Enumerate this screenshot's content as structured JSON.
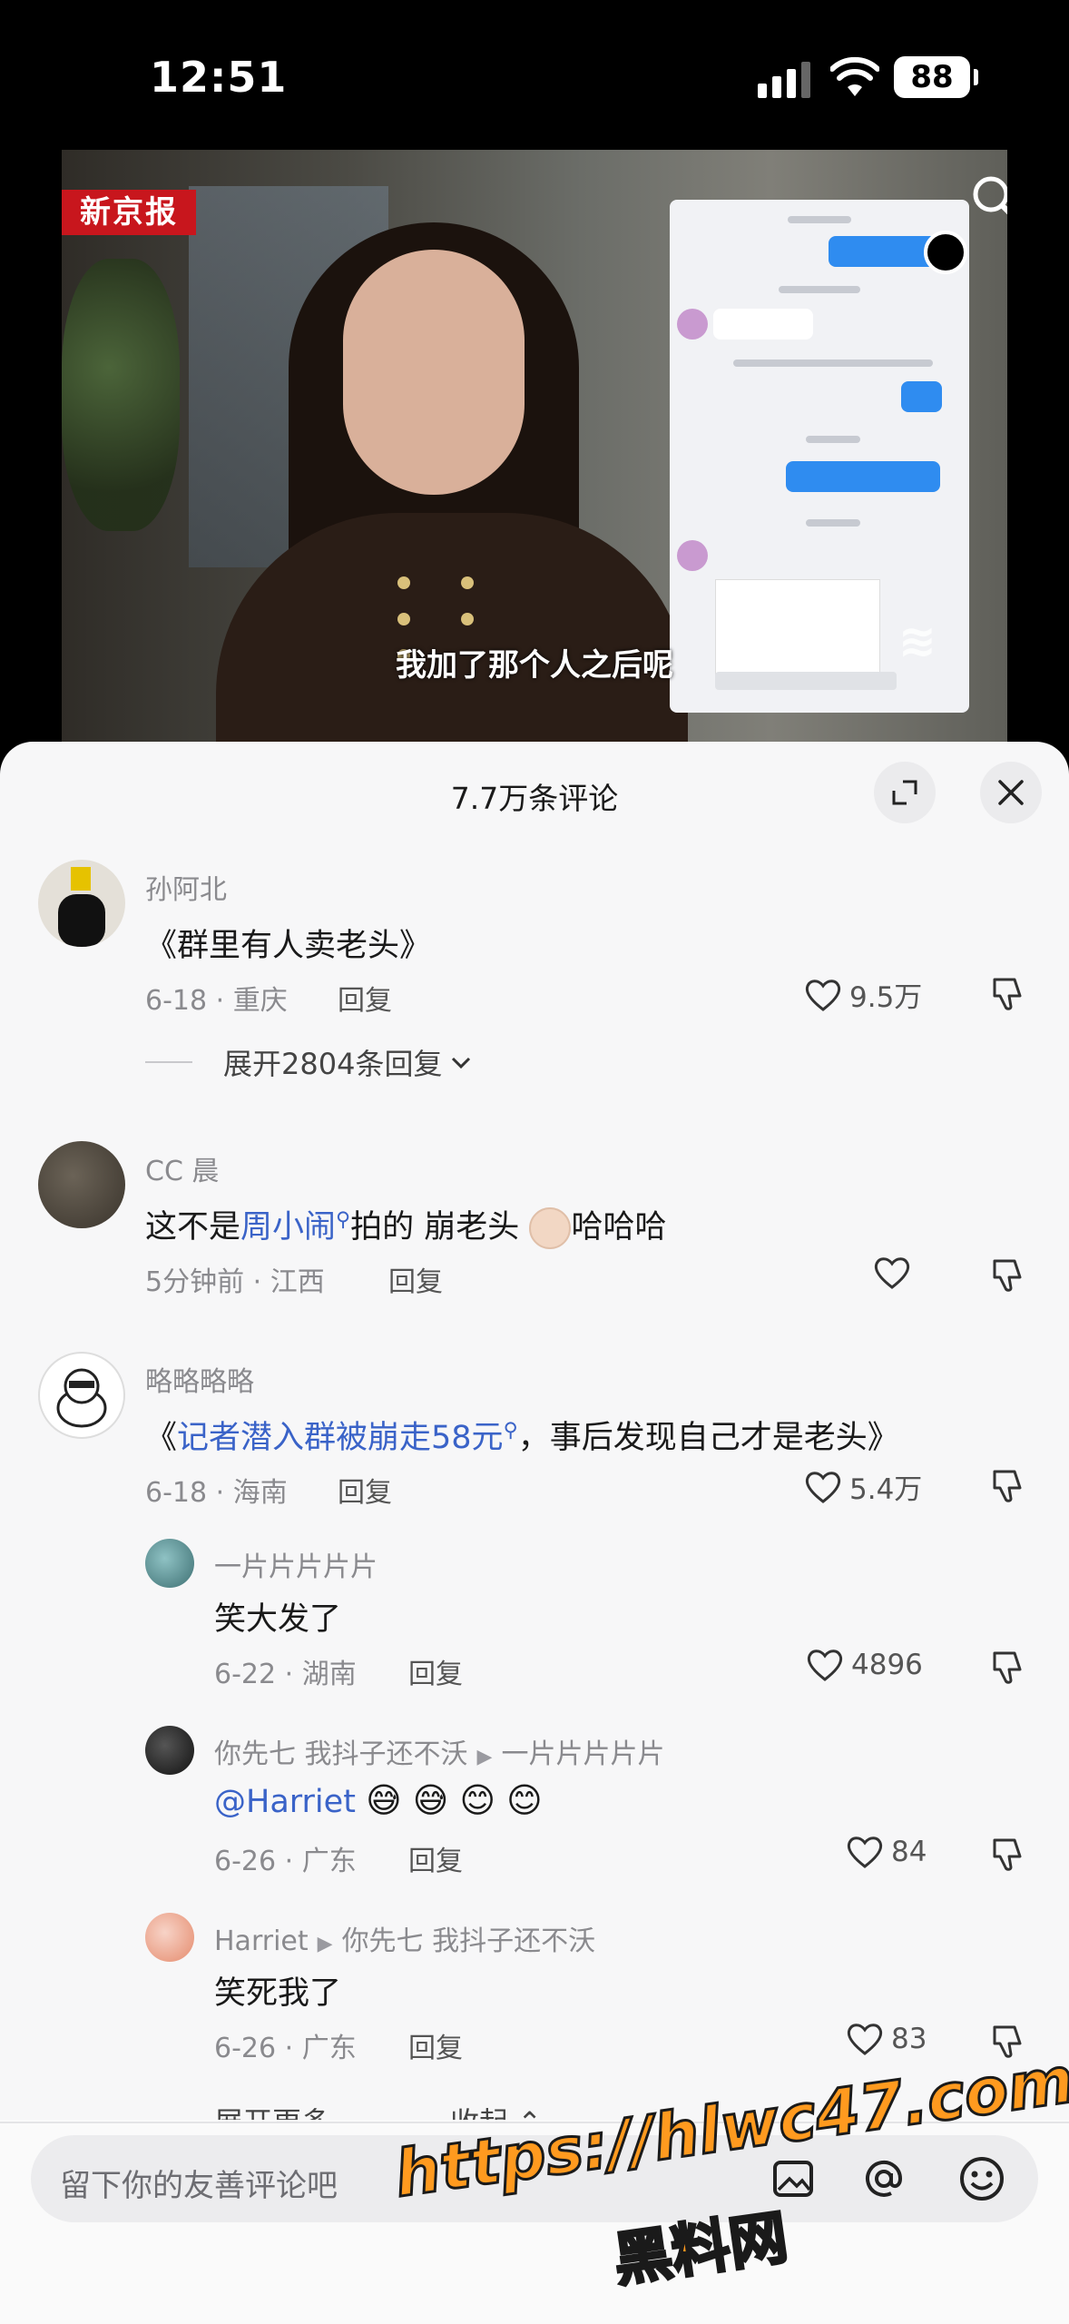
{
  "status_bar": {
    "time": "12:51",
    "battery": "88"
  },
  "video": {
    "brand": "新京报",
    "caption": "我加了那个人之后呢"
  },
  "sheet": {
    "title": "7.7万条评论"
  },
  "comments": [
    {
      "user": "孙阿北",
      "text": "《群里有人卖老头》",
      "meta": "6-18 · 重庆",
      "reply": "回复",
      "likes": "9.5万",
      "expand": "展开2804条回复"
    },
    {
      "user": "CC 晨",
      "text_before": "这不是",
      "link": "周小闹",
      "text_mid": "拍的  崩老头",
      "text_after": "哈哈哈",
      "meta": "5分钟前 · 江西",
      "reply": "回复"
    },
    {
      "user": "略略略略",
      "text_open": "《",
      "link": "记者潜入群被崩走58元",
      "text_after": "，事后发现自己才是老头》",
      "meta": "6-18 · 海南",
      "reply": "回复",
      "likes": "5.4万"
    }
  ],
  "replies": [
    {
      "user": "一片片片片片",
      "text": "笑大发了",
      "meta": "6-22 · 湖南",
      "reply": "回复",
      "likes": "4896"
    },
    {
      "user": "你先七 我抖子还不沃",
      "to": "一片片片片片",
      "mention": "@Harriet",
      "meta": "6-26 · 广东",
      "reply": "回复",
      "likes": "84"
    },
    {
      "user": "Harriet",
      "to": "你先七 我抖子还不沃",
      "text": "笑死我了",
      "meta": "6-26 · 广东",
      "reply": "回复",
      "likes": "83"
    }
  ],
  "footer": {
    "expand_more": "展开更多",
    "collapse": "收起",
    "placeholder": "留下你的友善评论吧"
  },
  "watermark": {
    "url": "https://hlwc47.com",
    "name": "黑料网"
  },
  "icons": [
    "search-icon",
    "fullscreen-icon",
    "close-icon",
    "heart-icon",
    "dislike-icon",
    "at-icon",
    "emoji-icon",
    "image-icon",
    "chevron-down-icon",
    "search-link-icon"
  ]
}
